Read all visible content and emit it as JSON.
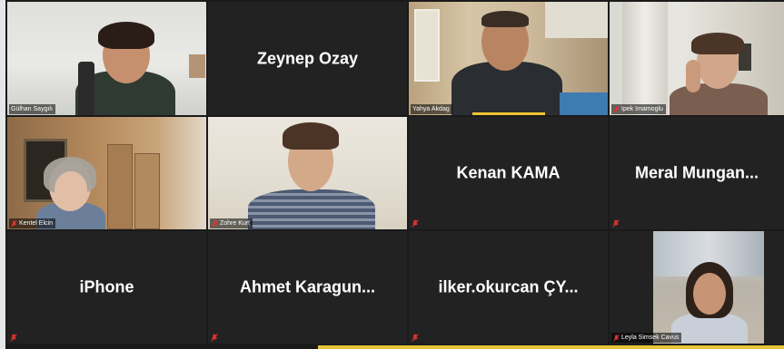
{
  "colors": {
    "active_border": "#c9e33d",
    "tile_bg": "#222222",
    "mute_icon": "#e0322f",
    "speaker_indicator": "#f1c232"
  },
  "participants": [
    {
      "name": "Gülhan Saygılı",
      "video": true,
      "active_speaker": true
    },
    {
      "name": "Zeynep Ozay",
      "video": false
    },
    {
      "name": "Yahya Akdag",
      "video": true
    },
    {
      "name": "Ipek Imamoglu",
      "video": true,
      "muted": true
    },
    {
      "name": "Kentel Elcin",
      "video": true,
      "muted": true
    },
    {
      "name": "Zohre Kurt",
      "video": true,
      "muted": true
    },
    {
      "name": "Kenan KAMA",
      "video": false,
      "muted": true
    },
    {
      "name": "Meral  Mungan...",
      "video": false,
      "muted": true
    },
    {
      "name": "iPhone",
      "video": false,
      "muted": true
    },
    {
      "name": "Ahmet  Karagun...",
      "video": false,
      "muted": true
    },
    {
      "name": "ilker.okurcan  ÇY...",
      "video": false,
      "muted": true
    },
    {
      "name": "Leyla Simsek Cavus",
      "video": true,
      "muted": true
    }
  ]
}
